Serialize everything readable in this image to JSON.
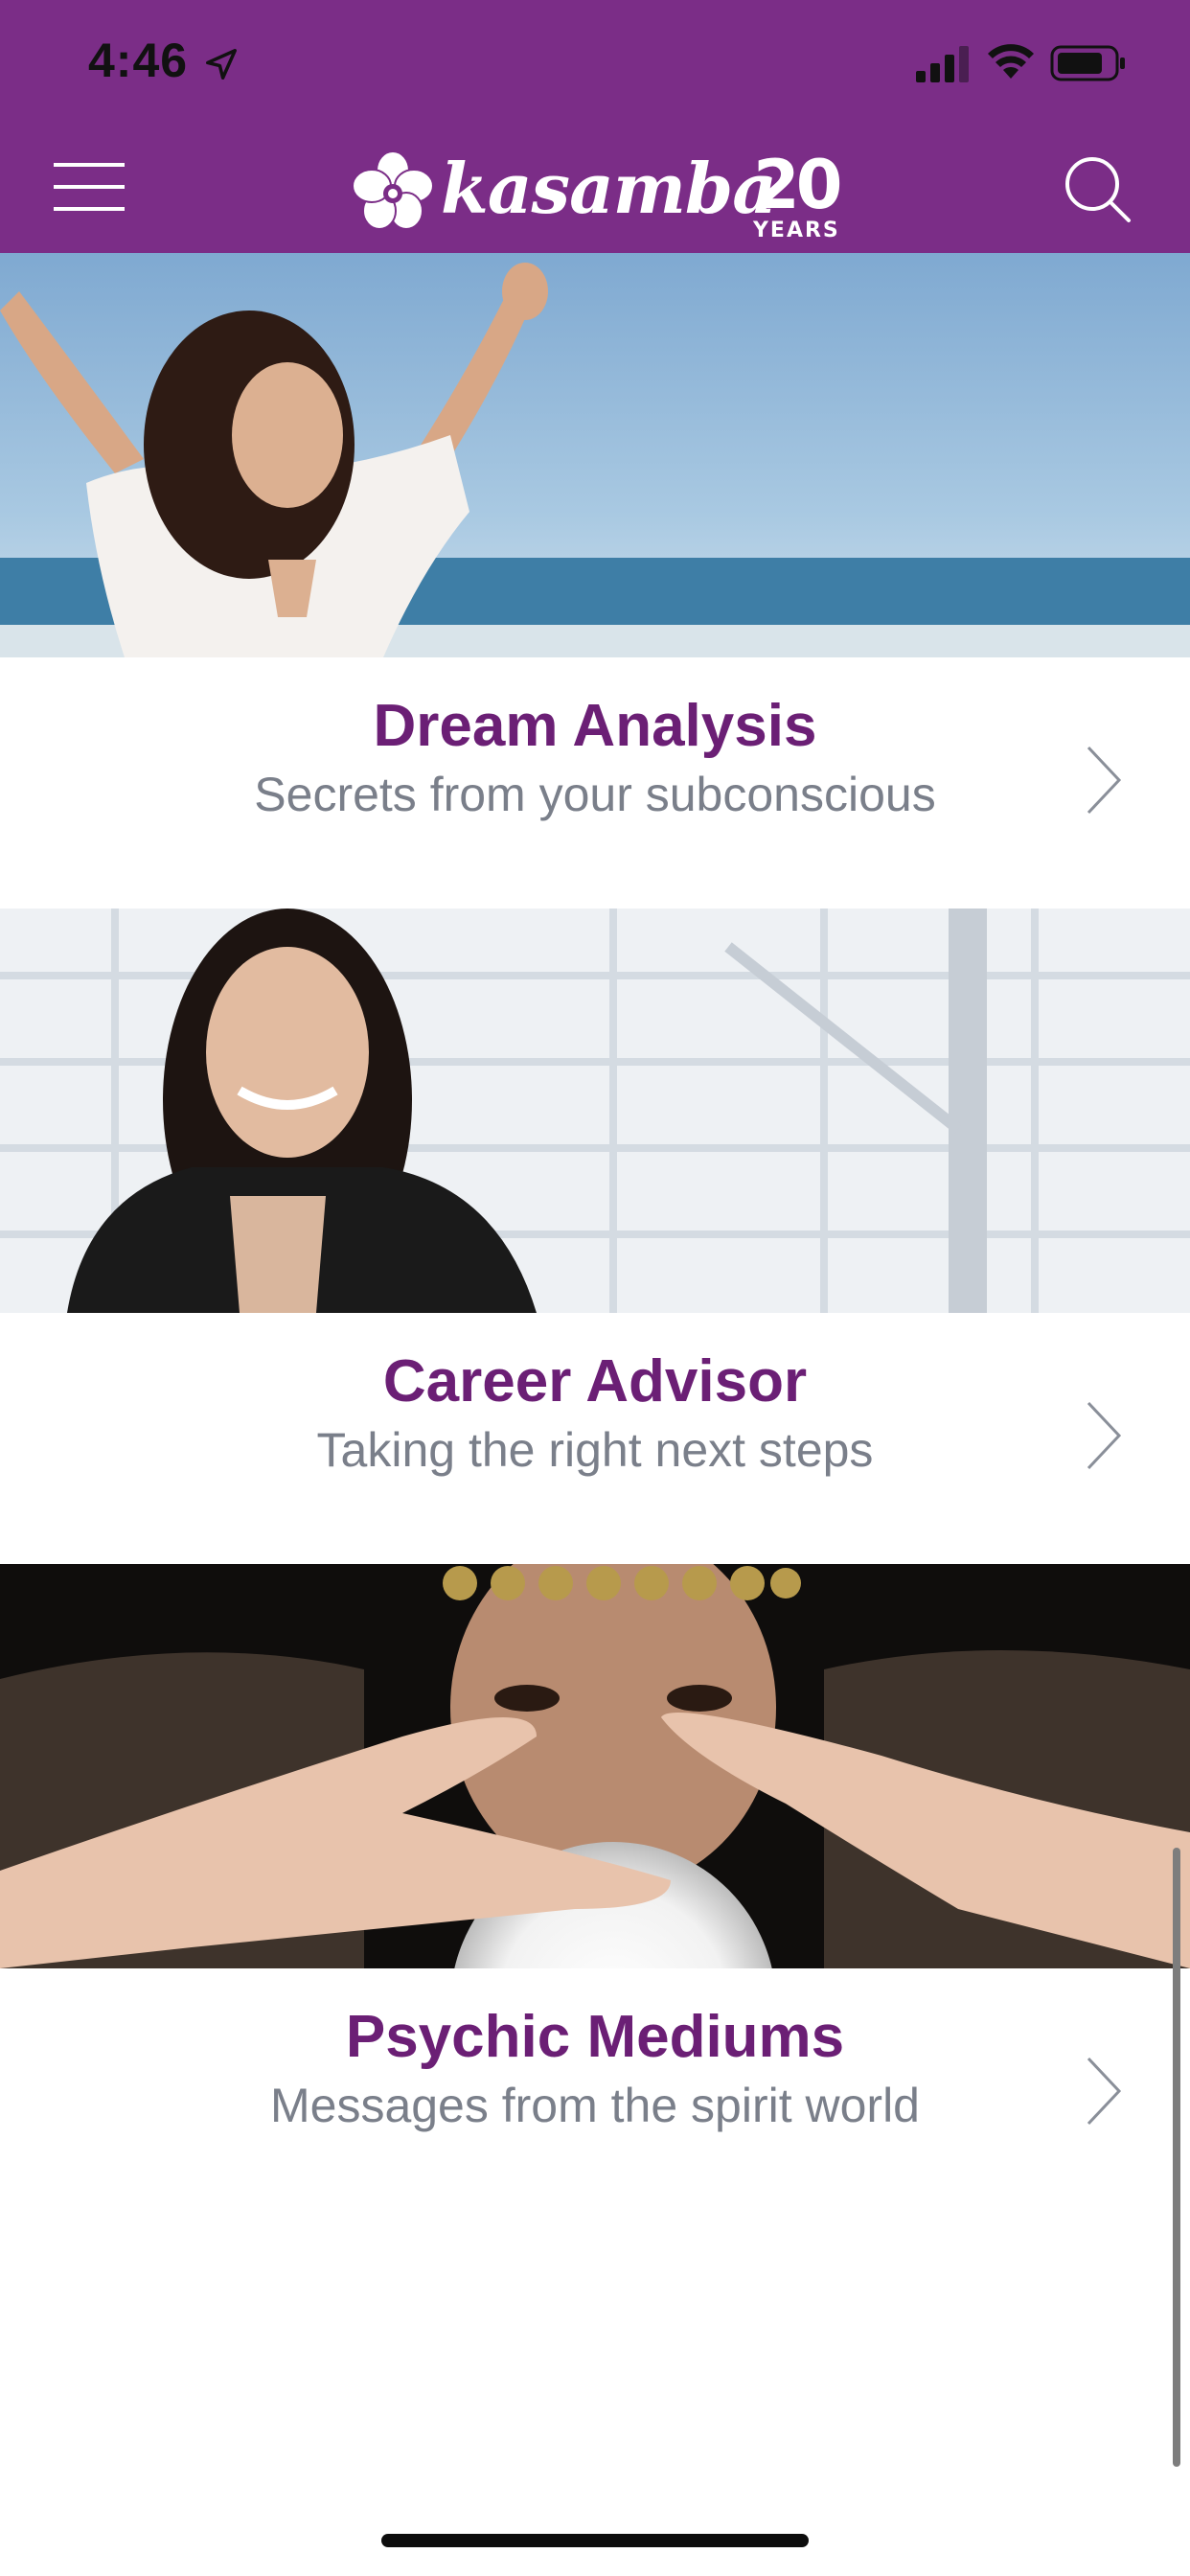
{
  "status_bar": {
    "time": "4:46",
    "icons": [
      "location-arrow-icon",
      "signal-icon",
      "wifi-icon",
      "battery-icon"
    ]
  },
  "header": {
    "brand": "kasamba",
    "anniversary_number": "20",
    "anniversary_label": "YEARS",
    "background_color": "#7b2d87",
    "icons": [
      "menu-icon",
      "kasamba-flower-logo",
      "search-icon"
    ]
  },
  "cards": [
    {
      "title": "Dream Analysis",
      "subtitle": "Secrets from your subconscious",
      "image": "woman-arms-raised-beach-photo"
    },
    {
      "title": "Career Advisor",
      "subtitle": "Taking the right next steps",
      "image": "smiling-businesswoman-photo"
    },
    {
      "title": "Psychic Mediums",
      "subtitle": "Messages from the spirit world",
      "image": "crystal-ball-psychic-photo"
    }
  ],
  "colors": {
    "title": "#6b1f75",
    "subtitle": "#7a7f8a",
    "chevron": "#8a8f99"
  }
}
